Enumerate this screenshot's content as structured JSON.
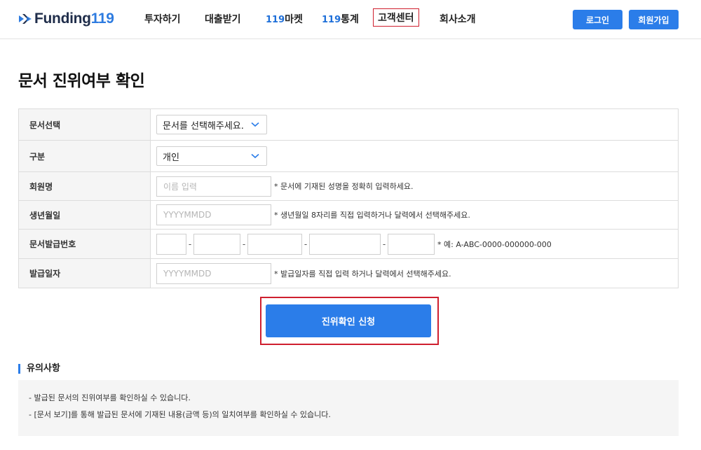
{
  "header": {
    "logo_text": "Funding",
    "logo_number": "119",
    "nav": [
      {
        "label": "투자하기"
      },
      {
        "label": "대출받기"
      },
      {
        "prefix": "119",
        "label": "마켓"
      },
      {
        "prefix": "119",
        "label": "통계"
      },
      {
        "label": "고객센터"
      },
      {
        "label": "회사소개"
      }
    ],
    "login_label": "로그인",
    "signup_label": "회원가입"
  },
  "page": {
    "title": "문서 진위여부 확인"
  },
  "form": {
    "doc_select": {
      "label": "문서선택",
      "value": "문서를 선택해주세요."
    },
    "type_select": {
      "label": "구분",
      "value": "개인"
    },
    "name": {
      "label": "회원명",
      "placeholder": "이름 입력",
      "hint": "* 문서에 기재된 성명을 정확히 입력하세요."
    },
    "birth": {
      "label": "생년월일",
      "placeholder": "YYYYMMDD",
      "hint": "* 생년월일 8자리를 직접 입력하거나 달력에서 선택해주세요."
    },
    "doc_number": {
      "label": "문서발급번호",
      "separator": "-",
      "hint": "* 예: A-ABC-0000-000000-000"
    },
    "issue_date": {
      "label": "발급일자",
      "placeholder": "YYYYMMDD",
      "hint": "* 발급일자를 직접 입력 하거나 달력에서 선택해주세요."
    },
    "submit_label": "진위확인 신청"
  },
  "notice": {
    "title": "유의사항",
    "lines": [
      "- 발급된 문서의 진위여부를 확인하실 수 있습니다.",
      "- [문서 보기]를 통해 발급된 문서에 기재된 내용(금액 등)의 일치여부를 확인하실 수 있습니다."
    ]
  },
  "colors": {
    "accent": "#2b7de9",
    "highlight_box": "#cf1f2e",
    "brand_dark": "#1f2d4a"
  }
}
